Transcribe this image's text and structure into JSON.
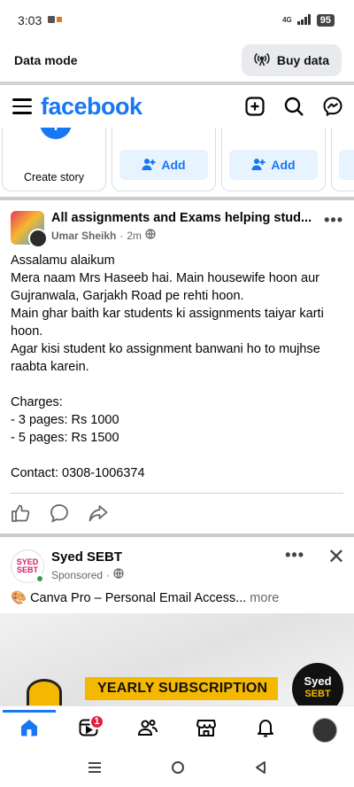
{
  "status": {
    "time": "3:03",
    "network": "4G",
    "battery": "95"
  },
  "data_bar": {
    "label": "Data mode",
    "button": "Buy data"
  },
  "header": {
    "logo": "facebook"
  },
  "stories": {
    "create_label": "Create story",
    "add_label": "Add"
  },
  "post": {
    "group_title": "All assignments and Exams helping stud...",
    "author": "Umar Sheikh",
    "time": "2m",
    "separator": "·",
    "more": "•••",
    "body": [
      "Assalamu alaikum",
      "Mera naam Mrs Haseeb hai. Main housewife hoon aur Gujranwala, Garjakh Road pe rehti hoon.",
      "Main ghar baith kar students ki assignments taiyar karti hoon.",
      "Agar kisi student ko assignment banwani ho to mujhse raabta karein.",
      "",
      "Charges:",
      "- 3 pages: Rs 1000",
      "- 5 pages: Rs 1500",
      "",
      "Contact: 0308-1006374"
    ]
  },
  "ad": {
    "name": "Syed SEBT",
    "sponsored": "Sponsored",
    "separator": "·",
    "more_menu": "•••",
    "close": "✕",
    "text": "🎨 Canva Pro – Personal Email Access...",
    "more": " more",
    "avatar_text": "SYED SEBT",
    "banner_text": "YEARLY SUBSCRIPTION",
    "seal_line1": "Syed",
    "seal_line2": "SEBT"
  },
  "bottom_nav": {
    "notifications_badge": "1"
  },
  "colors": {
    "brand": "#1877f2",
    "badge": "#e41e3f",
    "ad_yellow": "#f5b800"
  }
}
